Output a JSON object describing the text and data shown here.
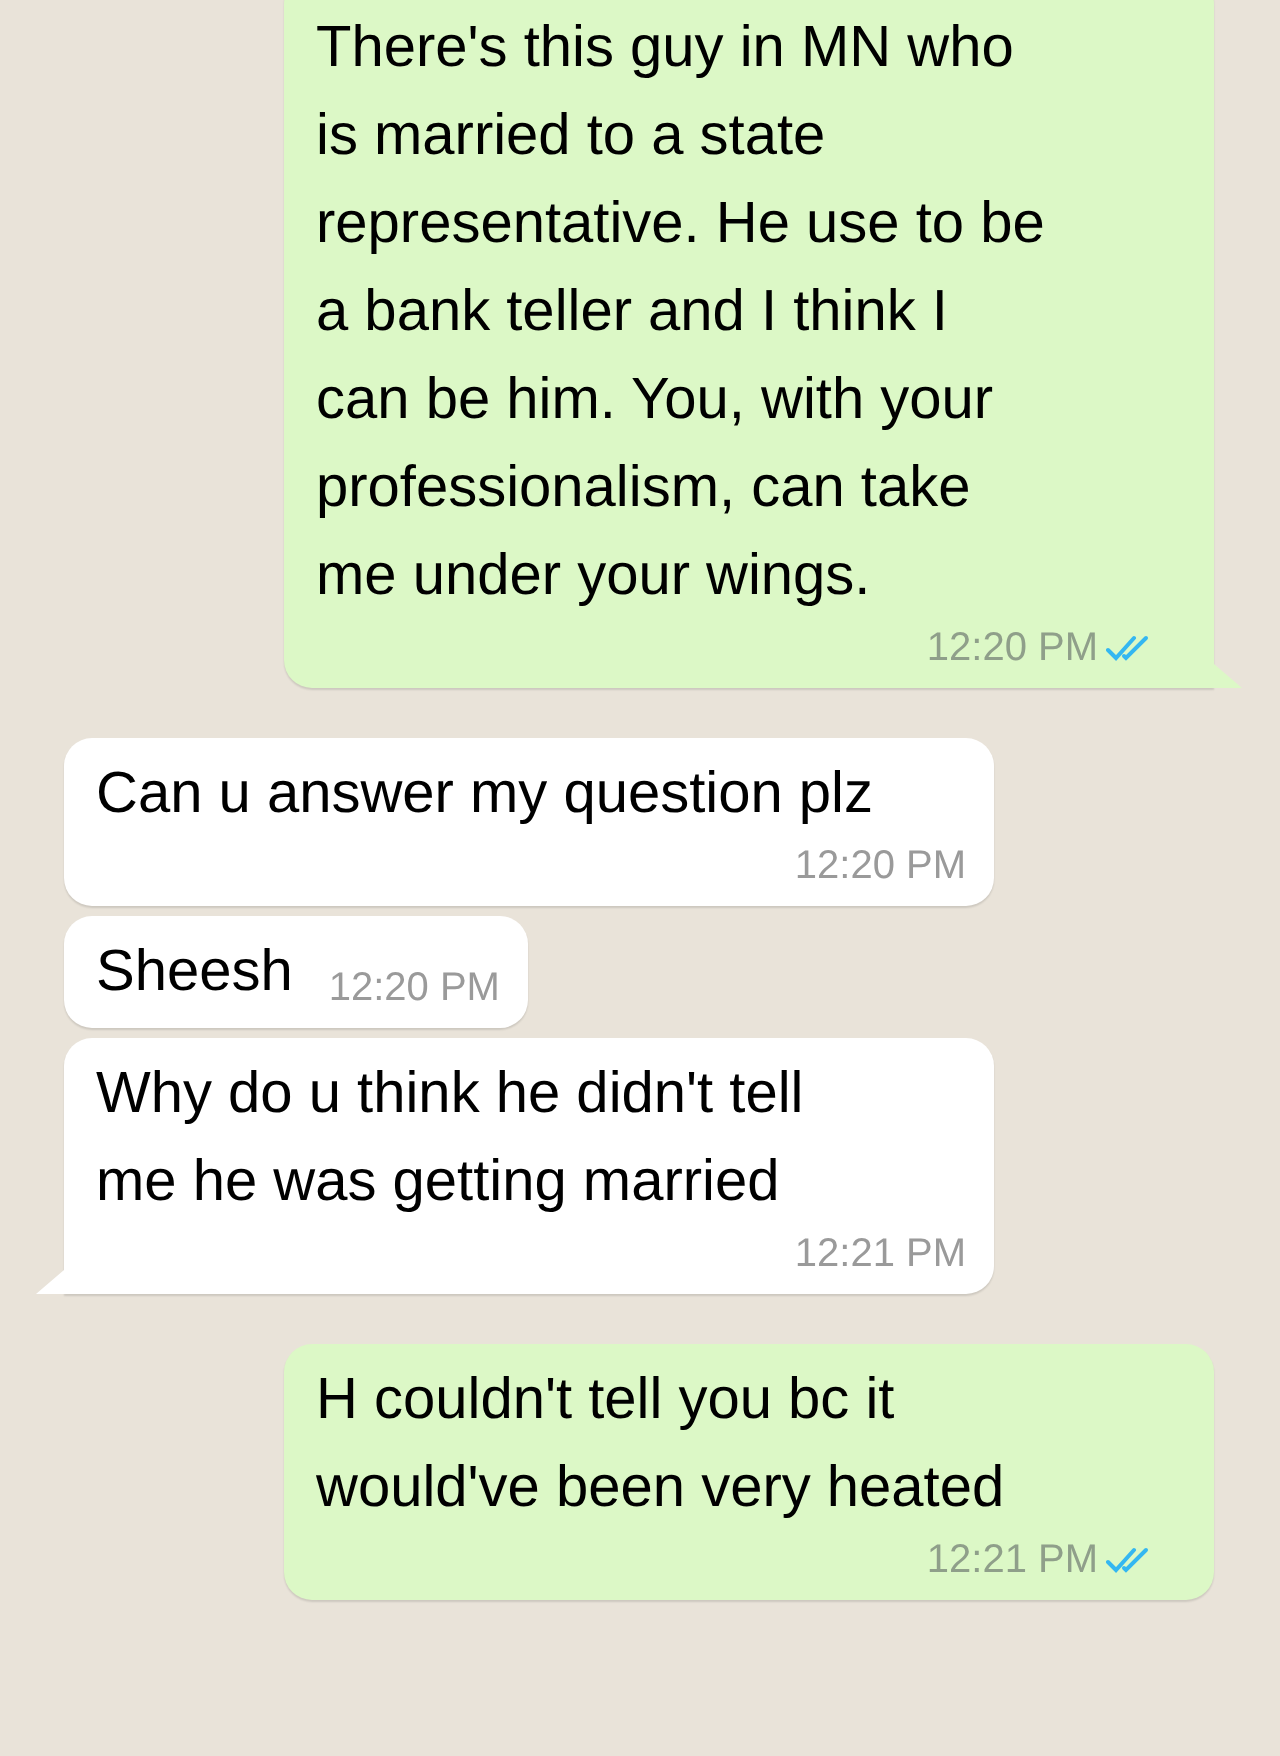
{
  "messages": [
    {
      "kind": "sent",
      "text": "There's this guy in MN who is married to a state representative. He use to be a bank teller and I think I can be him.  You, with your professionalism, can take me under your wings.",
      "time": "12:20 PM",
      "read": true,
      "tail": true
    },
    {
      "kind": "received",
      "text": "Can u answer my question plz",
      "time": "12:20 PM",
      "tail": false
    },
    {
      "kind": "received",
      "text": "Sheesh",
      "time": "12:20 PM",
      "tail": false
    },
    {
      "kind": "received",
      "text": "Why do u think he didn't tell me he was getting married",
      "time": "12:21 PM",
      "tail": true
    },
    {
      "kind": "sent",
      "text": "H couldn't tell you bc it would've been very heated",
      "time": "12:21 PM",
      "read": true,
      "tail": false
    }
  ]
}
